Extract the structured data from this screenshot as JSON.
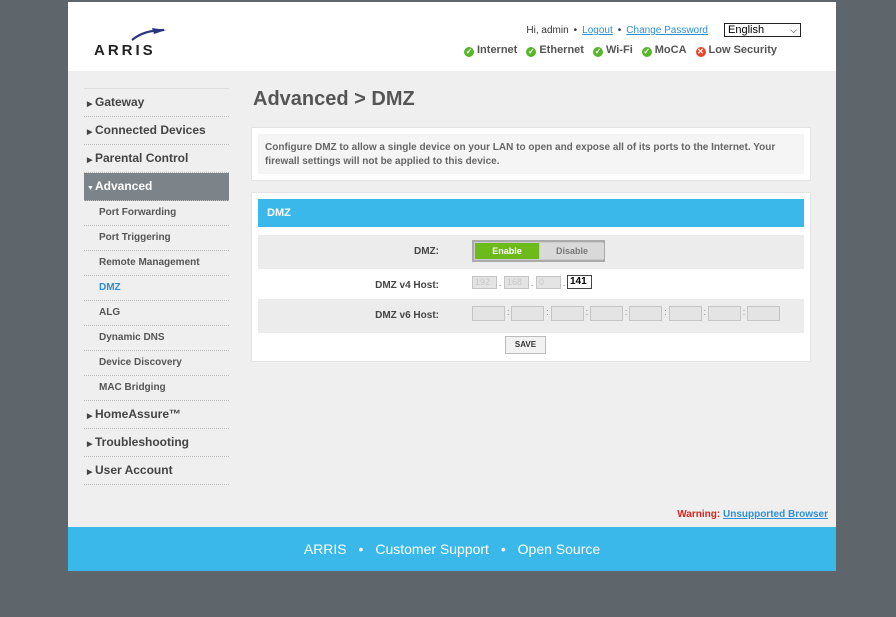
{
  "brand": {
    "logo_text": "ARRIS"
  },
  "user_bar": {
    "greeting": "Hi, admin",
    "logout": "Logout",
    "change_password": "Change Password"
  },
  "language": {
    "selected": "English"
  },
  "status_items": [
    {
      "label": "Internet",
      "state": "ok"
    },
    {
      "label": "Ethernet",
      "state": "ok"
    },
    {
      "label": "Wi-Fi",
      "state": "ok"
    },
    {
      "label": "MoCA",
      "state": "ok"
    },
    {
      "label": "Low Security",
      "state": "bad"
    }
  ],
  "sidebar": {
    "items": [
      {
        "label": "Gateway",
        "type": "top"
      },
      {
        "label": "Connected Devices",
        "type": "top"
      },
      {
        "label": "Parental Control",
        "type": "top"
      },
      {
        "label": "Advanced",
        "type": "top",
        "active": true
      },
      {
        "label": "Port Forwarding",
        "type": "sub"
      },
      {
        "label": "Port Triggering",
        "type": "sub"
      },
      {
        "label": "Remote Management",
        "type": "sub"
      },
      {
        "label": "DMZ",
        "type": "sub",
        "active": true
      },
      {
        "label": "ALG",
        "type": "sub"
      },
      {
        "label": "Dynamic DNS",
        "type": "sub"
      },
      {
        "label": "Device Discovery",
        "type": "sub"
      },
      {
        "label": "MAC Bridging",
        "type": "sub"
      },
      {
        "label": "HomeAssure™",
        "type": "top"
      },
      {
        "label": "Troubleshooting",
        "type": "top"
      },
      {
        "label": "User Account",
        "type": "top"
      }
    ]
  },
  "main": {
    "title": "Advanced > DMZ",
    "description": "Configure DMZ to allow a single device on your LAN to open and expose all of its ports to the Internet. Your firewall settings will not be applied to this device.",
    "panel_title": "DMZ",
    "dmz_label": "DMZ:",
    "enable_label": "Enable",
    "disable_label": "Disable",
    "dmz_enabled": true,
    "v4_label": "DMZ v4 Host:",
    "v4_octets": [
      "192",
      "168",
      "0",
      "141"
    ],
    "v6_label": "DMZ v6 Host:",
    "save_label": "SAVE"
  },
  "warning": {
    "label": "Warning:",
    "link": "Unsupported Browser"
  },
  "footer": {
    "items": [
      "ARRIS",
      "Customer Support",
      "Open Source"
    ],
    "separator": "•"
  },
  "colors": {
    "accent": "#3ab8ea",
    "enable_green": "#6dbb1a",
    "active_nav": "#7c8489",
    "link": "#2d8fd5"
  }
}
